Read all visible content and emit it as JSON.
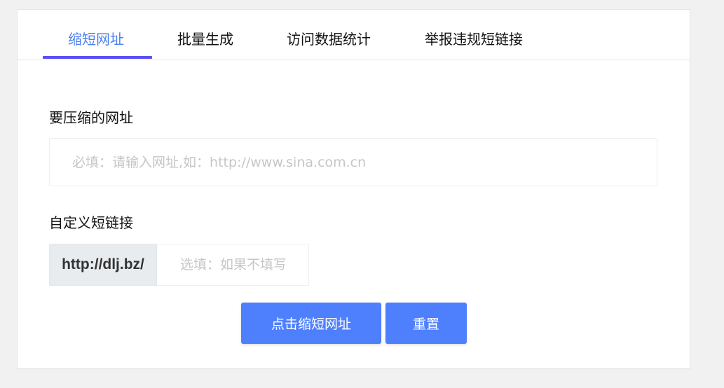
{
  "tabs": [
    {
      "label": "缩短网址",
      "active": true
    },
    {
      "label": "批量生成",
      "active": false
    },
    {
      "label": "访问数据统计",
      "active": false
    },
    {
      "label": "举报违规短链接",
      "active": false
    }
  ],
  "form": {
    "url_label": "要压缩的网址",
    "url_placeholder": "必填：请输入网址,如：http://www.sina.com.cn",
    "url_value": "",
    "custom_label": "自定义短链接",
    "custom_prefix": "http://dlj.bz/",
    "custom_placeholder": "选填：如果不填写将随机生成",
    "custom_value": "",
    "submit_label": "点击缩短网址",
    "reset_label": "重置"
  },
  "colors": {
    "accent": "#4a80f0",
    "tab_indicator": "#5b4ff5",
    "button": "#4e7ffd",
    "background": "#f1f1f1"
  }
}
